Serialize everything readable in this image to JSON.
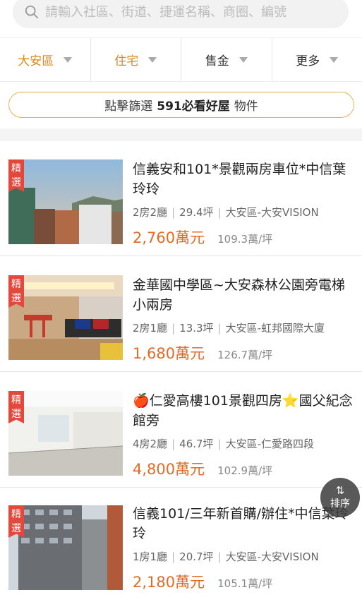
{
  "search": {
    "placeholder": "請輸入社區、街道、捷運名稱、商圈、編號"
  },
  "filters": [
    {
      "label": "大安區"
    },
    {
      "label": "住宅"
    },
    {
      "label": "售金"
    },
    {
      "label": "更多"
    }
  ],
  "banner": {
    "prefix": "點擊篩選",
    "highlight": "591必看好屋",
    "suffix": "物件"
  },
  "listings": [
    {
      "tag": "精選",
      "title": "信義安和101*景觀兩房車位*中信葉玲玲",
      "layout": "2房2廳",
      "size": "29.4坪",
      "location": "大安區-大安VISION",
      "price": "2,760萬元",
      "unit_price": "109.3萬/坪"
    },
    {
      "tag": "精選",
      "title": "金華國中學區~大安森林公園旁電梯小兩房",
      "layout": "2房1廳",
      "size": "13.3坪",
      "location": "大安區-虹邦國際大廈",
      "price": "1,680萬元",
      "unit_price": "126.7萬/坪"
    },
    {
      "tag": "精選",
      "title": "🍎仁愛高樓101景觀四房⭐國父紀念館旁",
      "layout": "4房2廳",
      "size": "46.7坪",
      "location": "大安區-仁愛路四段",
      "price": "4,800萬元",
      "unit_price": "102.9萬/坪"
    },
    {
      "tag": "精選",
      "title": "信義101/三年新首購/辦住*中信葉玲玲",
      "layout": "1房1廳",
      "size": "20.7坪",
      "location": "大安區-大安VISION",
      "price": "2,180萬元",
      "unit_price": "105.1萬/坪"
    }
  ],
  "sort_button": {
    "arrows": "⇅",
    "label": "排序"
  },
  "colors": {
    "accent": "#d98a1e",
    "price": "#e26b25",
    "tag": "#e2483c"
  },
  "icons": {
    "search": "search-icon",
    "caret": "caret-down-icon"
  }
}
